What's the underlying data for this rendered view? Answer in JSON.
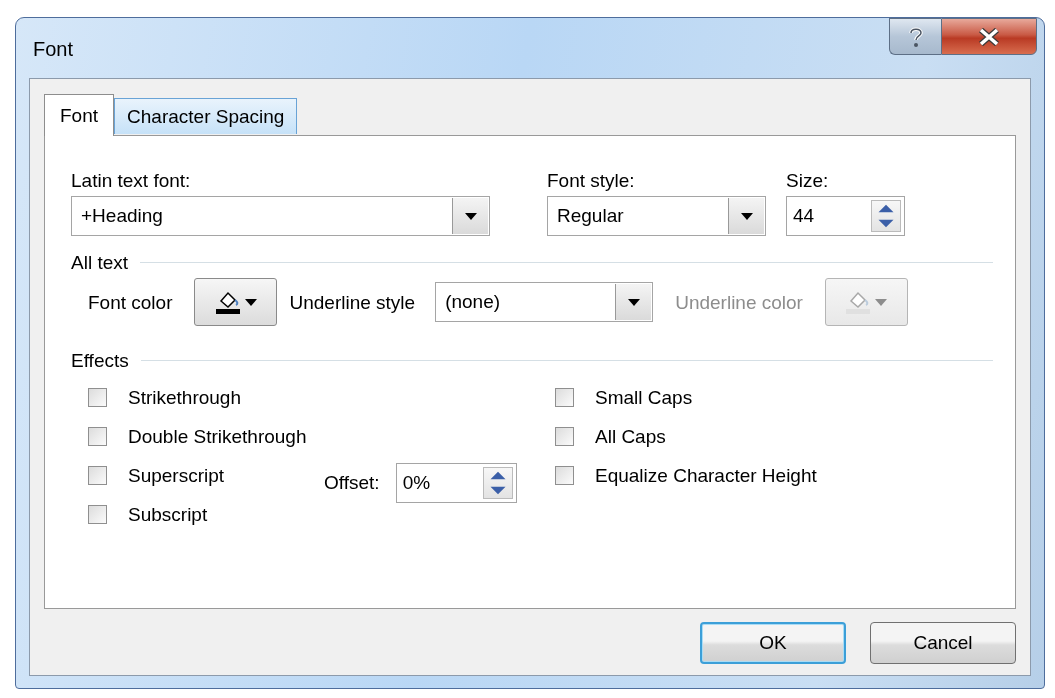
{
  "window": {
    "title": "Font"
  },
  "tabs": [
    {
      "label": "Font",
      "selected": true
    },
    {
      "label": "Character Spacing",
      "selected": false
    }
  ],
  "font_fields": {
    "latin_text_font": {
      "label": "Latin text font:",
      "value": "+Heading"
    },
    "font_style": {
      "label": "Font style:",
      "value": "Regular"
    },
    "size": {
      "label": "Size:",
      "value": "44"
    }
  },
  "all_text": {
    "heading": "All text",
    "font_color": {
      "label": "Font color"
    },
    "underline_style": {
      "label": "Underline style",
      "value": "(none)"
    },
    "underline_color": {
      "label": "Underline color",
      "disabled": true
    }
  },
  "effects": {
    "heading": "Effects",
    "left": [
      {
        "label": "Strikethrough",
        "checked": false
      },
      {
        "label": "Double Strikethrough",
        "checked": false
      },
      {
        "label": "Superscript",
        "checked": false
      },
      {
        "label": "Subscript",
        "checked": false
      }
    ],
    "offset": {
      "label": "Offset:",
      "value": "0%"
    },
    "right": [
      {
        "label": "Small Caps",
        "checked": false
      },
      {
        "label": "All Caps",
        "checked": false
      },
      {
        "label": "Equalize Character Height",
        "checked": false
      }
    ]
  },
  "buttons": [
    {
      "label": "OK",
      "default": true
    },
    {
      "label": "Cancel",
      "default": false
    }
  ]
}
